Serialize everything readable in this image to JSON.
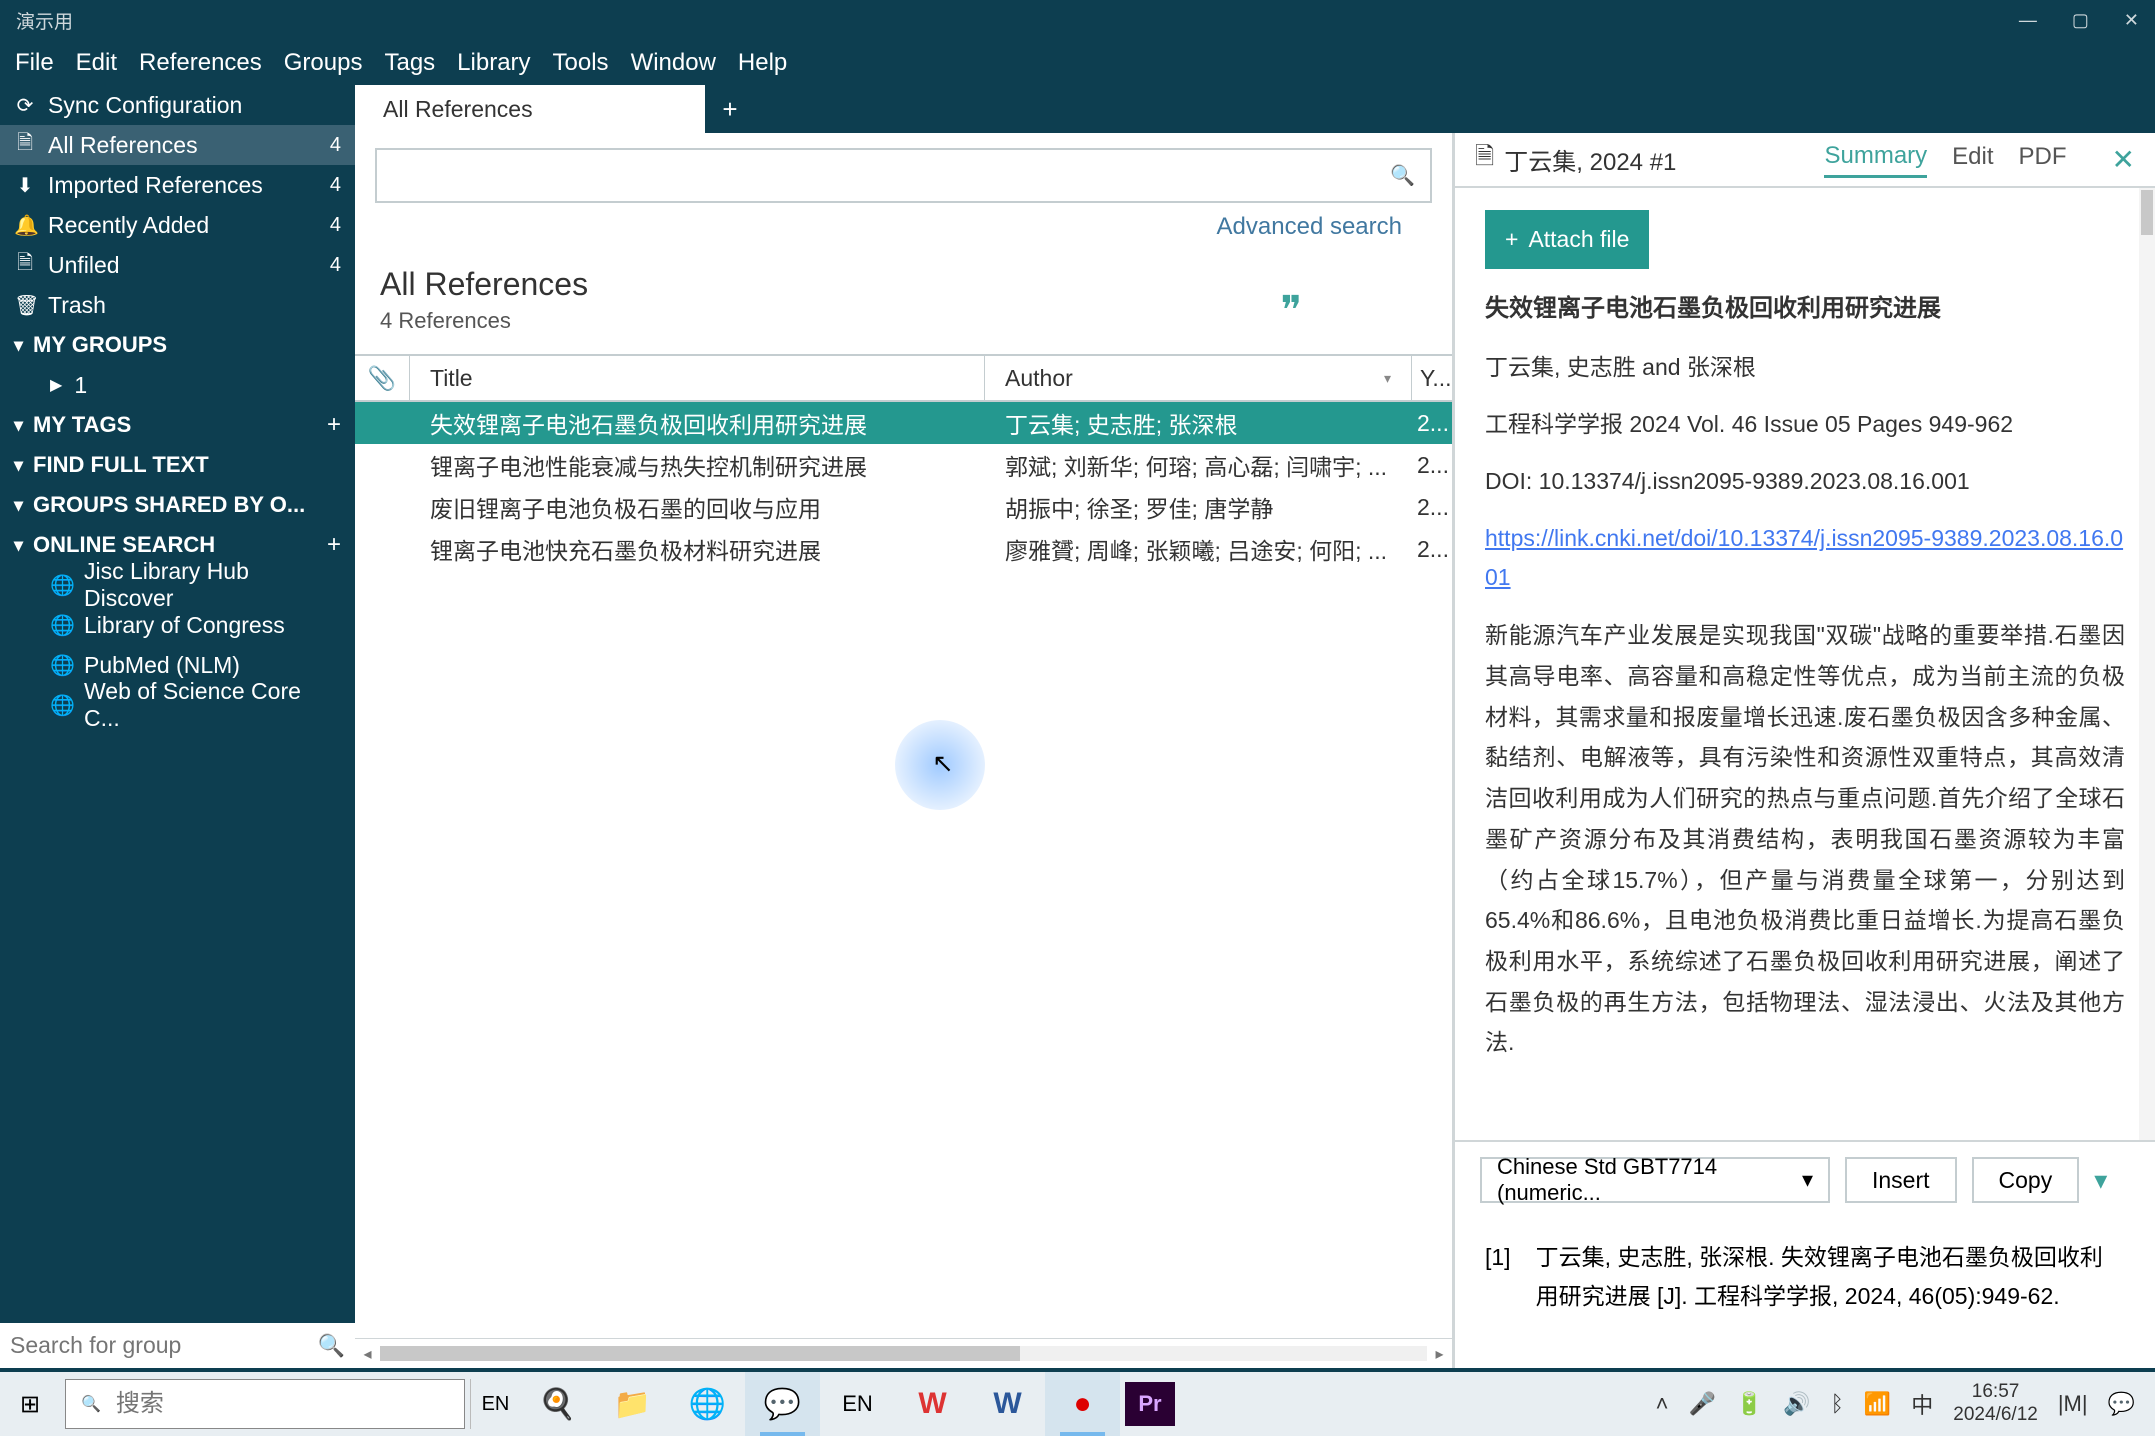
{
  "window": {
    "title": "演示用"
  },
  "menu": [
    "File",
    "Edit",
    "References",
    "Groups",
    "Tags",
    "Library",
    "Tools",
    "Window",
    "Help"
  ],
  "sidebar": {
    "sync": "Sync Configuration",
    "items": [
      {
        "label": "All References",
        "count": "4",
        "active": true
      },
      {
        "label": "Imported References",
        "count": "4"
      },
      {
        "label": "Recently Added",
        "count": "4"
      },
      {
        "label": "Unfiled",
        "count": "4"
      },
      {
        "label": "Trash"
      }
    ],
    "groups": {
      "my_groups": "MY GROUPS",
      "group1": "1",
      "my_tags": "MY TAGS",
      "find_full": "FIND FULL TEXT",
      "shared": "GROUPS SHARED BY O...",
      "online": "ONLINE SEARCH",
      "online_items": [
        "Jisc Library Hub Discover",
        "Library of Congress",
        "PubMed (NLM)",
        "Web of Science Core C..."
      ]
    },
    "search_placeholder": "Search for group"
  },
  "tab": {
    "label": "All References"
  },
  "search": {
    "advanced": "Advanced search"
  },
  "list": {
    "title": "All References",
    "subtitle": "4 References",
    "cols": {
      "title": "Title",
      "author": "Author",
      "year": "Y..."
    },
    "rows": [
      {
        "title": "失效锂离子电池石墨负极回收利用研究进展",
        "author": "丁云集; 史志胜; 张深根",
        "year": "2..."
      },
      {
        "title": "锂离子电池性能衰减与热失控机制研究进展",
        "author": "郭斌; 刘新华; 何瑢; 高心磊; 闫啸宇; ...",
        "year": "2..."
      },
      {
        "title": "废旧锂离子电池负极石墨的回收与应用",
        "author": "胡振中; 徐圣; 罗佳; 唐学静",
        "year": "2..."
      },
      {
        "title": "锂离子电池快充石墨负极材料研究进展",
        "author": "廖雅贇; 周峰; 张颖曦; 吕途安; 何阳; ...",
        "year": "2..."
      }
    ]
  },
  "detail": {
    "ref_id": "丁云集, 2024 #1",
    "tabs": {
      "summary": "Summary",
      "edit": "Edit",
      "pdf": "PDF"
    },
    "attach": "Attach file",
    "title": "失效锂离子电池石墨负极回收利用研究进展",
    "authors": "丁云集, 史志胜 and 张深根",
    "meta": "工程科学学报 2024 Vol. 46 Issue 05 Pages 949-962",
    "doi": "DOI: 10.13374/j.issn2095-9389.2023.08.16.001",
    "url": "https://link.cnki.net/doi/10.13374/j.issn2095-9389.2023.08.16.001",
    "abstract": "新能源汽车产业发展是实现我国\"双碳\"战略的重要举措.石墨因其高导电率、高容量和高稳定性等优点，成为当前主流的负极材料，其需求量和报废量增长迅速.废石墨负极因含多种金属、黏结剂、电解液等，具有污染性和资源性双重特点，其高效清洁回收利用成为人们研究的热点与重点问题.首先介绍了全球石墨矿产资源分布及其消费结构，表明我国石墨资源较为丰富（约占全球15.7%），但产量与消费量全球第一，分别达到65.4%和86.6%，且电池负极消费比重日益增长.为提高石墨负极利用水平，系统综述了石墨负极回收利用研究进展，阐述了石墨负极的再生方法，包括物理法、湿法浸出、火法及其他方法."
  },
  "cite": {
    "style": "Chinese Std GBT7714 (numeric...",
    "insert": "Insert",
    "copy": "Copy",
    "num": "[1]",
    "text": "丁云集, 史志胜, 张深根. 失效锂离子电池石墨负极回收利用研究进展 [J]. 工程科学学报, 2024, 46(05):949-62."
  },
  "taskbar": {
    "search_placeholder": "搜索",
    "lang_indicator": "EN",
    "ime": "中",
    "time": "16:57",
    "date": "2024/6/12"
  }
}
